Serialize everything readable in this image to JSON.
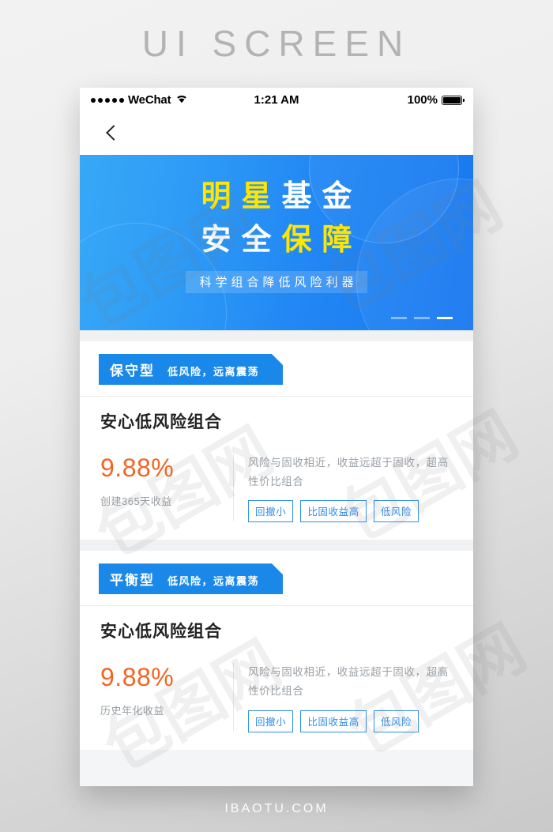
{
  "page": {
    "header_title": "UI SCREEN",
    "footer_text": "IBAOTU.COM"
  },
  "statusbar": {
    "carrier": "WeChat",
    "wifi_icon": "wifi-icon",
    "time": "1:21 AM",
    "battery_percent": "100%",
    "battery_icon": "battery-full-icon"
  },
  "navbar": {
    "back_icon": "back-chevron-icon"
  },
  "banner": {
    "line1_part1": "明星",
    "line1_part2": "基金",
    "line2_part1": "安全",
    "line2_part2": "保障",
    "subtitle": "科学组合降低风险利器",
    "dots": [
      "inactive",
      "inactive",
      "active"
    ],
    "color_light": "#37a8f7",
    "color_dark": "#1878f0",
    "color_accent_yellow": "#ffe600"
  },
  "cards": [
    {
      "tag_type": "保守型",
      "tag_desc": "低风险，远离震荡",
      "title": "安心低风险组合",
      "metric_value": "9.88%",
      "metric_label": "创建365天收益",
      "description": "风险与固收相近，收益远超于固收，超高性价比组合",
      "chips": [
        "回撤小",
        "比固收益高",
        "低风险"
      ]
    },
    {
      "tag_type": "平衡型",
      "tag_desc": "低风险，远离震荡",
      "title": "安心低风险组合",
      "metric_value": "9.88%",
      "metric_label": "历史年化收益",
      "description": "风险与固收相近，收益远超于固收，超高性价比组合",
      "chips": [
        "回撤小",
        "比固收益高",
        "低风险"
      ]
    }
  ],
  "watermark": {
    "text": "包图网"
  },
  "colors": {
    "accent_orange": "#f26522",
    "accent_blue": "#1a88e8",
    "chip_blue": "#2f8fe8"
  }
}
